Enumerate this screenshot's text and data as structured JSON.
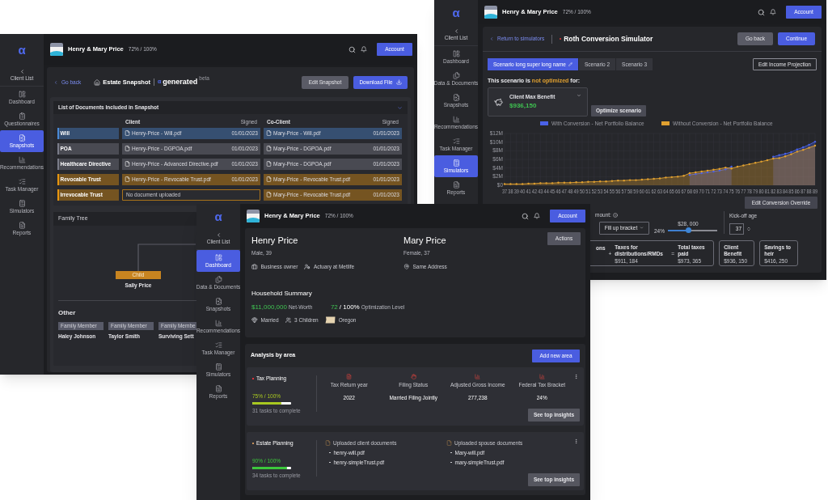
{
  "estate_window": {
    "header": {
      "client": "Henry & Mary Price",
      "progress": "72% / 100%",
      "account": "Account"
    },
    "sidebar": {
      "logo": "α",
      "back": "Client List",
      "items": [
        {
          "label": "Dashboard",
          "selected": false
        },
        {
          "label": "Questionnaires",
          "selected": false
        },
        {
          "label": "Snapshots",
          "selected": true
        },
        {
          "label": "Recommendations",
          "selected": false
        },
        {
          "label": "Task Manager",
          "selected": false
        },
        {
          "label": "Simulators",
          "selected": false
        },
        {
          "label": "Reports",
          "selected": false
        }
      ]
    },
    "go_back": "Go back",
    "title": "Estate Snapshot",
    "brand_logo": "α",
    "brand": "generated",
    "brand_tag": "beta",
    "buttons": [
      {
        "label": "Edit Snapshot",
        "kind": "secondary"
      },
      {
        "label": "Download File",
        "kind": "primary"
      }
    ],
    "documents": {
      "title": "List of Documents Included in Snapshot",
      "columns": [
        "Client",
        "Signed",
        "Co-Client",
        "Signed"
      ],
      "rows": [
        {
          "label": "Will",
          "color": "#4a8ad6",
          "client": {
            "kind": "file",
            "name": "Henry-Price - Will.pdf",
            "signed": "01/01/2023"
          },
          "co_client": {
            "kind": "file",
            "name": "Mary-Price - Will.pdf",
            "signed": "01/01/2023"
          }
        },
        {
          "label": "POA",
          "color": "#7a7c89",
          "client": {
            "kind": "file",
            "name": "Henry-Price - DGPOA.pdf",
            "signed": "01/01/2023"
          },
          "co_client": {
            "kind": "file",
            "name": "Mary-Price - DGPOA.pdf",
            "signed": "01/01/2023"
          }
        },
        {
          "label": "Healthcare Directive",
          "color": "#7a7c89",
          "client": {
            "kind": "file",
            "name": "Henry-Price - Advanced Directive.pdf",
            "signed": "01/01/2023"
          },
          "co_client": {
            "kind": "file",
            "name": "Mary-Price - DGPOA.pdf",
            "signed": "01/01/2023"
          }
        },
        {
          "label": "Revocable Trust",
          "color": "#e8960f",
          "client": {
            "kind": "file",
            "name": "Henry-Price - Revocable Trust.pdf",
            "signed": "01/01/2023"
          },
          "co_client": {
            "kind": "file",
            "name": "Mary-Price - Revocable Trust.pdf",
            "signed": "01/01/2023"
          }
        },
        {
          "label": "Irrevocable Trust",
          "color": "#e8960f",
          "client": {
            "kind": "missing",
            "name": "No document uploaded"
          },
          "co_client": {
            "kind": "file",
            "name": "Mary-Price - Revocable Trust.pdf",
            "signed": "01/01/2023"
          }
        }
      ]
    },
    "family_tree": {
      "title": "Family Tree",
      "members": [
        {
          "role": "Child",
          "name": "Sally Price"
        }
      ],
      "other_title": "Other",
      "others": [
        {
          "role": "Family Member",
          "name": "Haley Johnson"
        },
        {
          "role": "Family Member",
          "name": "Taylor Smith"
        },
        {
          "role": "Family Membe",
          "name": "Surviving Sett"
        }
      ]
    }
  },
  "roth_window": {
    "header": {
      "client": "Henry & Mary Price",
      "progress": "72% / 100%",
      "account": "Account"
    },
    "sidebar": {
      "logo": "α",
      "back": "Client List",
      "items": [
        {
          "label": "Dashboard",
          "selected": false
        },
        {
          "label": "Data & Documents",
          "selected": false
        },
        {
          "label": "Snapshots",
          "selected": false
        },
        {
          "label": "Recommendations",
          "selected": false
        },
        {
          "label": "Task Manager",
          "selected": false
        },
        {
          "label": "Simulators",
          "selected": true
        },
        {
          "label": "Reports",
          "selected": false
        }
      ]
    },
    "back_link": "Return to simulators",
    "title": "Roth Conversion Simulator",
    "buttons": [
      {
        "label": "Go back",
        "kind": "secondary"
      },
      {
        "label": "Continue",
        "kind": "primary"
      }
    ],
    "scenarios": [
      {
        "label": "Scenario long super long name",
        "selected": true
      },
      {
        "label": "Scenario 2",
        "selected": false
      },
      {
        "label": "Scenario 3",
        "selected": false
      }
    ],
    "edit_income": "Edit Income Projection",
    "notice": {
      "before": "This scenario is ",
      "highlight": "not optimized",
      "after": " for:"
    },
    "goal": {
      "label": "Client Max Benefit",
      "value": "$936,150"
    },
    "optimize": "Optimize scenario",
    "chart_data": {
      "type": "area",
      "grid": true,
      "legend": "top",
      "x": [
        37,
        38,
        39,
        40,
        41,
        42,
        43,
        44,
        45,
        46,
        47,
        48,
        49,
        50,
        51,
        52,
        53,
        54,
        55,
        56,
        57,
        58,
        59,
        60,
        61,
        62,
        63,
        64,
        65,
        66,
        67,
        68,
        69,
        70,
        71,
        72,
        73,
        74,
        75,
        76,
        77,
        78,
        79,
        80,
        81,
        82,
        83,
        84,
        85,
        86,
        87,
        88,
        89
      ],
      "ylim": [
        0,
        12
      ],
      "yticks": [
        {
          "value": 0,
          "label": "$0"
        },
        {
          "value": 2,
          "label": "$2M"
        },
        {
          "value": 4,
          "label": "$4M"
        },
        {
          "value": 6,
          "label": "$6M"
        },
        {
          "value": 8,
          "label": "$8M"
        },
        {
          "value": 10,
          "label": "$10M"
        },
        {
          "value": 12,
          "label": "$12M"
        }
      ],
      "series": [
        {
          "name": "With Conversion - Net Portfolio Balance",
          "color": "#4a62e8",
          "values": [
            null,
            null,
            null,
            null,
            null,
            null,
            null,
            null,
            null,
            null,
            null,
            null,
            null,
            null,
            null,
            null,
            null,
            null,
            null,
            null,
            null,
            null,
            null,
            null,
            null,
            null,
            null,
            null,
            null,
            null,
            null,
            2.4,
            2.6,
            2.8,
            3.0,
            3.2,
            3.4,
            3.7,
            4.3,
            null,
            null,
            null,
            null,
            null,
            null,
            6.6,
            7.0,
            7.3,
            7.7,
            8.3,
            8.8,
            9.4,
            10.1
          ]
        },
        {
          "name": "Without Conversion - Net Portfolio Balance",
          "color": "#e0a030",
          "values": [
            0.3,
            0.3,
            0.3,
            0.3,
            0.4,
            0.4,
            0.5,
            0.5,
            0.5,
            0.6,
            0.6,
            0.6,
            0.7,
            0.7,
            0.8,
            0.8,
            0.9,
            0.9,
            1.0,
            1.1,
            1.1,
            1.2,
            1.2,
            1.3,
            1.4,
            1.5,
            1.6,
            1.8,
            1.9,
            2.0,
            2.2,
            2.8,
            3.0,
            3.2,
            3.4,
            3.6,
            3.8,
            4.1,
            3.9,
            4.3,
            4.6,
            4.9,
            5.2,
            5.5,
            5.8,
            6.2,
            6.3,
            6.7,
            7.2,
            7.8,
            8.2,
            8.7,
            9.2
          ]
        }
      ]
    },
    "override": "Edit Conversion Override",
    "controls": {
      "amount_label": "mount:",
      "strategy": "Fill up bracket",
      "bracket": "24%",
      "slider": {
        "level": 0.41,
        "reading": "$28, 000"
      },
      "kickoff_label": "Kick-off age",
      "kickoff": "37"
    },
    "tax_sum": {
      "first_label": "ons",
      "terms": [
        {
          "op": "+",
          "label": "Taxes for distributions/RMDs",
          "value": "$911, 184"
        },
        {
          "op": "=",
          "label": "Total taxes paid",
          "value": "$973, 365"
        }
      ]
    },
    "results": [
      {
        "label": "Client Benefit",
        "value": "$936, 150"
      },
      {
        "label": "Savings to heir",
        "value": "$416, 250"
      }
    ]
  },
  "dashboard_window": {
    "header": {
      "client": "Henry & Mary Price",
      "progress": "72% / 100%",
      "account": "Account"
    },
    "sidebar": {
      "logo": "α",
      "back": "Client List",
      "items": [
        {
          "label": "Dashboard",
          "selected": true
        },
        {
          "label": "Data & Documents",
          "selected": false
        },
        {
          "label": "Snapshots",
          "selected": false
        },
        {
          "label": "Recommendations",
          "selected": false
        },
        {
          "label": "Task Manager",
          "selected": false
        },
        {
          "label": "Simulators",
          "selected": false
        },
        {
          "label": "Reports",
          "selected": false
        }
      ]
    },
    "persons": [
      {
        "name": "Henry Price",
        "details": "Male, 39",
        "facts": [
          {
            "kind": "job",
            "text": "Business owner"
          },
          {
            "kind": "employer",
            "text": "Actuary at Metlife"
          }
        ]
      },
      {
        "name": "Mary Price",
        "details": "Female, 37",
        "facts": [
          {
            "kind": "address",
            "text": "Same Address"
          }
        ]
      }
    ],
    "actions": "Actions",
    "household": {
      "title": "Household Summary",
      "net_worth": "$11,000,000",
      "net_worth_label": "Net-Worth",
      "score": "72",
      "score_total": "/ 100%",
      "score_label": "Optimization Level",
      "facts": [
        {
          "kind": "marital",
          "text": "Married"
        },
        {
          "kind": "children",
          "text": "3 Children"
        },
        {
          "kind": "state",
          "text": "Oregon"
        }
      ]
    },
    "analysis": {
      "title": "Analysis by area",
      "add": "Add new area",
      "areas": [
        {
          "kind": "metrics",
          "name": "Tax Planning",
          "color": "#e0323a",
          "progress": "75% / 100%",
          "level": 0.75,
          "tasks": "31 tasks to complete",
          "insights": "See top insights",
          "metrics": [
            {
              "label": "Tax Return year",
              "value": "2022"
            },
            {
              "label": "Filing Status",
              "value": "Married Filing Jointly"
            },
            {
              "label": "Adjusted Gross Income",
              "value": "277,238"
            },
            {
              "label": "Federal Tax Bracket",
              "value": "24%"
            }
          ]
        },
        {
          "kind": "documents",
          "name": "Estate Planning",
          "color": "#c8925a",
          "progress": "90% / 100%",
          "level": 0.9,
          "tasks": "34 tasks to complete",
          "insights": "See top insights",
          "documents": [
            {
              "label": "Uploaded client documents",
              "files": [
                "henry-will.pdf",
                "henry-simpleTrust.pdf"
              ]
            },
            {
              "label": "Uploaded spouse documents",
              "files": [
                "Mary-will.pdf",
                "mary-simpleTrust.pdf"
              ]
            }
          ]
        }
      ]
    }
  }
}
